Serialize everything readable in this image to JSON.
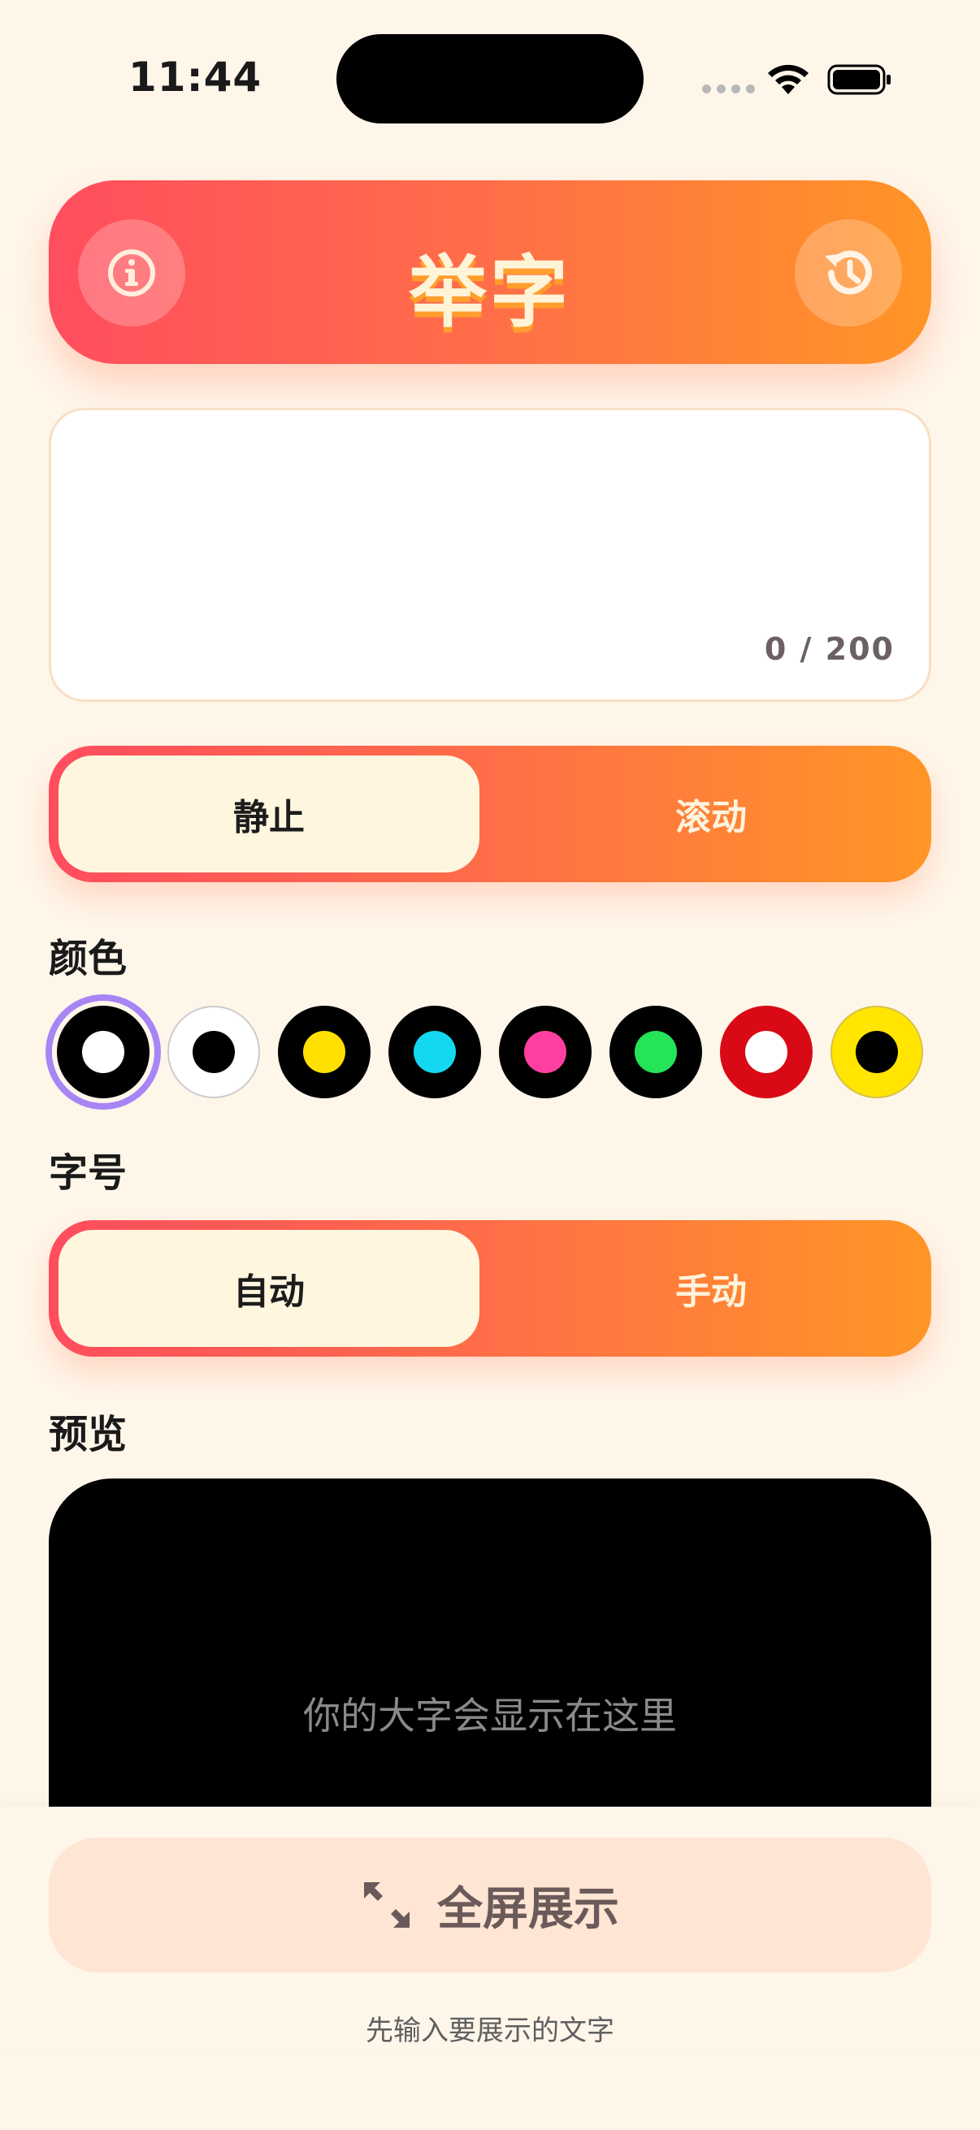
{
  "status_bar": {
    "time": "11:44"
  },
  "header": {
    "title": "举字",
    "info_icon": "info-icon",
    "history_icon": "history-icon"
  },
  "text_input": {
    "value": "",
    "placeholder": "",
    "counter": "0 / 200"
  },
  "mode": {
    "options": [
      "静止",
      "滚动"
    ],
    "selected": "静止"
  },
  "color": {
    "label": "颜色",
    "swatches": [
      {
        "bg": "#000000",
        "fg": "#FFFFFF",
        "selected": true
      },
      {
        "bg": "#FFFFFF",
        "fg": "#000000",
        "selected": false
      },
      {
        "bg": "#000000",
        "fg": "#FFE000",
        "selected": false
      },
      {
        "bg": "#000000",
        "fg": "#14D8F0",
        "selected": false
      },
      {
        "bg": "#000000",
        "fg": "#FF3FA0",
        "selected": false
      },
      {
        "bg": "#000000",
        "fg": "#24E458",
        "selected": false
      },
      {
        "bg": "#D90A16",
        "fg": "#FFFFFF",
        "selected": false
      },
      {
        "bg": "#FFE500",
        "fg": "#000000",
        "selected": false
      }
    ]
  },
  "font_size": {
    "label": "字号",
    "options": [
      "自动",
      "手动"
    ],
    "selected": "自动"
  },
  "preview": {
    "label": "预览",
    "placeholder_text": "你的大字会显示在这里"
  },
  "fullscreen": {
    "label": "全屏展示",
    "hint": "先输入要展示的文字",
    "icon": "expand-icon"
  },
  "colors": {
    "accent_start": "#FF4D5E",
    "accent_end": "#FF9526",
    "background": "#FFF6EA",
    "selection_ring": "#A885F5"
  }
}
